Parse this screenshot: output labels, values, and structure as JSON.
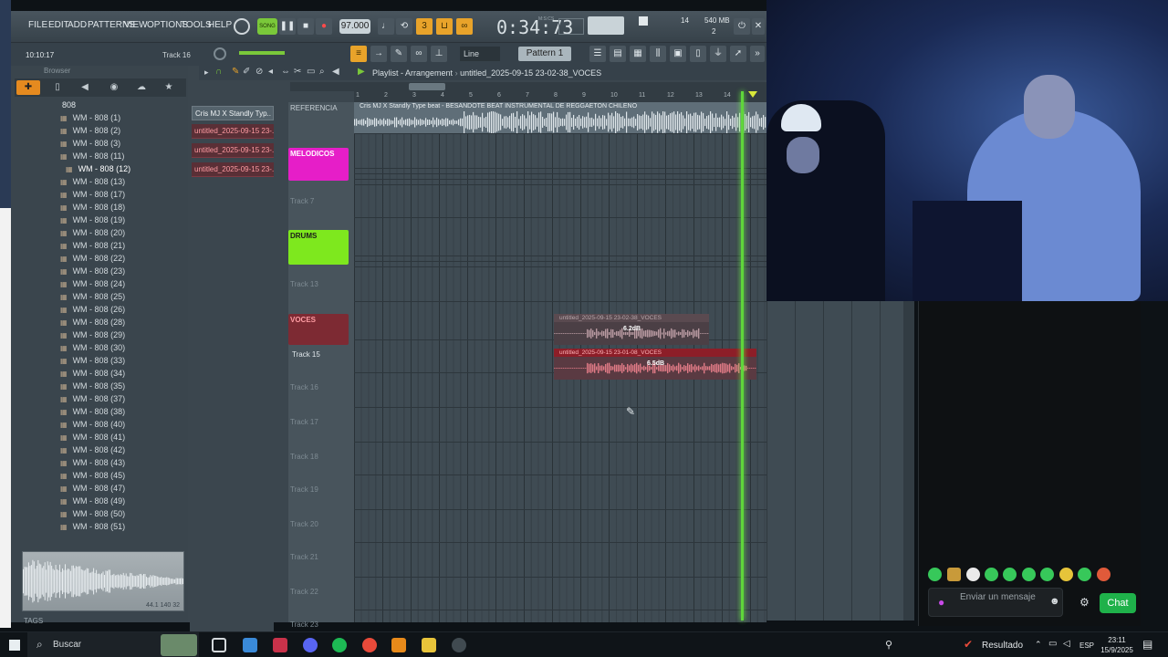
{
  "menu": [
    "FILE",
    "EDIT",
    "ADD",
    "PATTERNS",
    "VIEW",
    "OPTIONS",
    "TOOLS",
    "HELP"
  ],
  "transport": {
    "song_label": "SONG",
    "bpm": "97.000",
    "time": "0:34:73",
    "time_unit": "M:S:CS",
    "cpu": "14",
    "memory": "540 MB",
    "voices": "2"
  },
  "toolbar": {
    "snap": "Line",
    "pattern": "Pattern 1"
  },
  "clock": "10:10:17",
  "hint_track": "Track 16",
  "browser": {
    "title": "Browser",
    "folder": "808",
    "files": [
      "WM - 808 (1)",
      "WM - 808 (2)",
      "WM - 808 (3)",
      "WM - 808 (11)",
      "WM - 808 (12)",
      "WM - 808 (13)",
      "WM - 808 (17)",
      "WM - 808 (18)",
      "WM - 808 (19)",
      "WM - 808 (20)",
      "WM - 808 (21)",
      "WM - 808 (22)",
      "WM - 808 (23)",
      "WM - 808 (24)",
      "WM - 808 (25)",
      "WM - 808 (26)",
      "WM - 808 (28)",
      "WM - 808 (29)",
      "WM - 808 (30)",
      "WM - 808 (33)",
      "WM - 808 (34)",
      "WM - 808 (35)",
      "WM - 808 (37)",
      "WM - 808 (38)",
      "WM - 808 (40)",
      "WM - 808 (41)",
      "WM - 808 (42)",
      "WM - 808 (43)",
      "WM - 808 (45)",
      "WM - 808 (47)",
      "WM - 808 (49)",
      "WM - 808 (50)",
      "WM - 808 (51)"
    ],
    "selected_index": 4,
    "wave_info": "44.1 140 32",
    "tags": "TAGS"
  },
  "picker": [
    "Cris MJ X Standly Typ..",
    "untitled_2025-09-15 23-..",
    "untitled_2025-09-15 23-..",
    "untitled_2025-09-15 23-.."
  ],
  "playlist": {
    "title": "Playlist - Arrangement",
    "project": "untitled_2025-09-15 23-02-38_VOCES",
    "ruler": [
      "1",
      "2",
      "3",
      "4",
      "5",
      "6",
      "7",
      "8",
      "9",
      "10",
      "11",
      "12",
      "13",
      "14"
    ],
    "tracks": {
      "referencia": "REFERENCIA",
      "melodicos": "MELODICOS",
      "track7": "Track 7",
      "drums": "DRUMS",
      "track13": "Track 13",
      "voces": "VOCES",
      "track15": "Track 15",
      "track16": "Track 16",
      "track17": "Track 17",
      "track18": "Track 18",
      "track19": "Track 19",
      "track20": "Track 20",
      "track21": "Track 21",
      "track22": "Track 22",
      "track23": "Track 23"
    },
    "ref_clip": "Cris MJ X Standly Type beat - BESANDOTE  BEAT INSTRUMENTAL DE REGGAETON CHILENO",
    "clip1": {
      "name": "untitled_2025-09-15 23-02-38_VOCES",
      "gain": "6.2dB"
    },
    "clip2": {
      "name": "untitled_2025-09-15 23-01-08_VOCES",
      "gain": "6.5dB"
    }
  },
  "chat": {
    "placeholder": "Enviar un mensaje",
    "button": "Chat"
  },
  "taskbar": {
    "search": "Buscar",
    "resultado": "Resultado",
    "lang": "ESP",
    "time": "23:11",
    "date": "15/9/2025"
  },
  "colors": {
    "melodicos": "#e61ec8",
    "drums": "#7ee81e",
    "voces": "#7d2a33",
    "playhead": "#5fd63b",
    "chat_button": "#1fb14a",
    "accent_orange": "#e8a32a"
  }
}
